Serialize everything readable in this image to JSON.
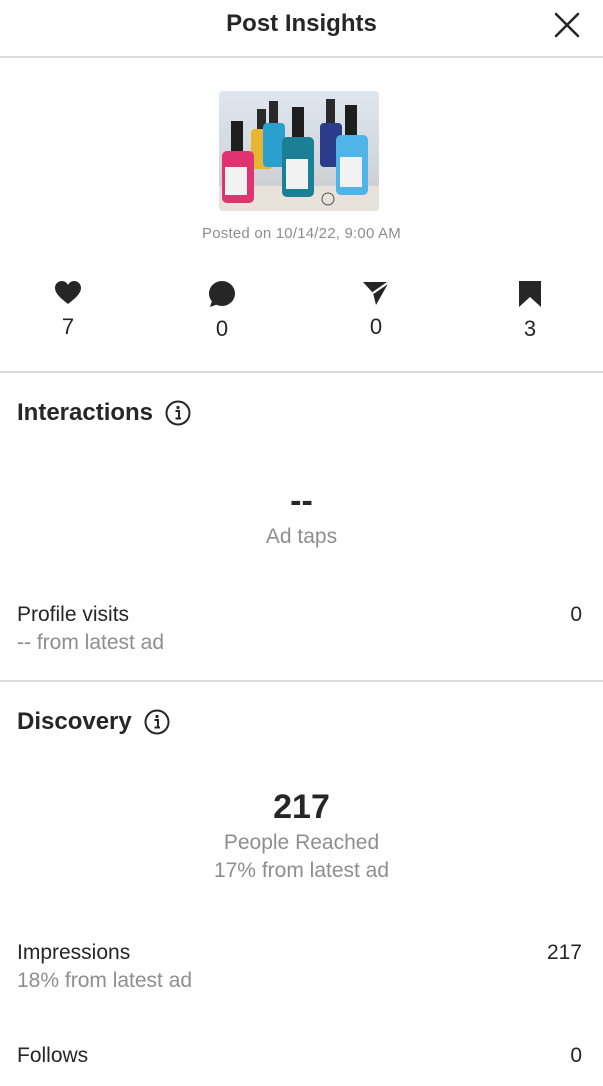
{
  "header": {
    "title": "Post Insights",
    "close_icon": "close-icon"
  },
  "post": {
    "thumbnail": "ink-bottles-photo",
    "posted_on": "Posted on 10/14/22, 9:00 AM"
  },
  "stats": [
    {
      "icon": "heart-icon",
      "value": "7"
    },
    {
      "icon": "comment-icon",
      "value": "0"
    },
    {
      "icon": "share-icon",
      "value": "0"
    },
    {
      "icon": "bookmark-icon",
      "value": "3"
    }
  ],
  "interactions": {
    "title": "Interactions",
    "metric_value": "--",
    "metric_label": "Ad taps",
    "rows": [
      {
        "label": "Profile visits",
        "sub": "-- from latest ad",
        "value": "0"
      }
    ]
  },
  "discovery": {
    "title": "Discovery",
    "metric_value": "217",
    "metric_label": "People Reached",
    "metric_sub": "17% from latest ad",
    "rows": [
      {
        "label": "Impressions",
        "sub": "18% from latest ad",
        "value": "217"
      },
      {
        "label": "Follows",
        "value": "0"
      }
    ]
  },
  "colors": {
    "text": "#262626",
    "muted": "#8e8e8e",
    "divider": "#dbdbdb"
  }
}
